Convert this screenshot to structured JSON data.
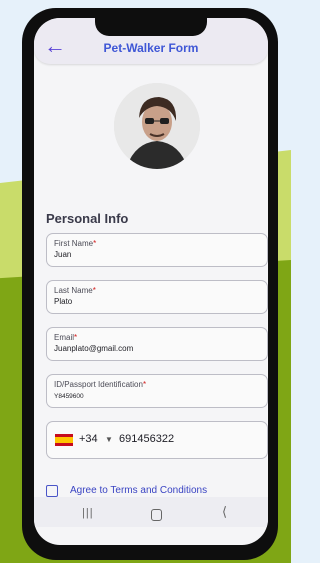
{
  "header": {
    "title": "Pet-Walker Form",
    "back_icon": "arrow-left-icon"
  },
  "section_title": "Personal Info",
  "fields": [
    {
      "label": "First Name",
      "required": "*",
      "value": "Juan"
    },
    {
      "label": "Last Name",
      "required": "*",
      "value": "Plato"
    },
    {
      "label": "Email",
      "required": "*",
      "value": "Juanplato@gmail.com"
    },
    {
      "label": "ID/Passport Identification",
      "required": "*",
      "value": "Y8459600"
    }
  ],
  "phone": {
    "country_code": "+34",
    "number": "691456322",
    "flag": "spain-flag-icon"
  },
  "terms": {
    "label": "Agree to Terms and Conditions"
  },
  "colors": {
    "accent": "#3f57d6",
    "required": "#d01b1b"
  }
}
